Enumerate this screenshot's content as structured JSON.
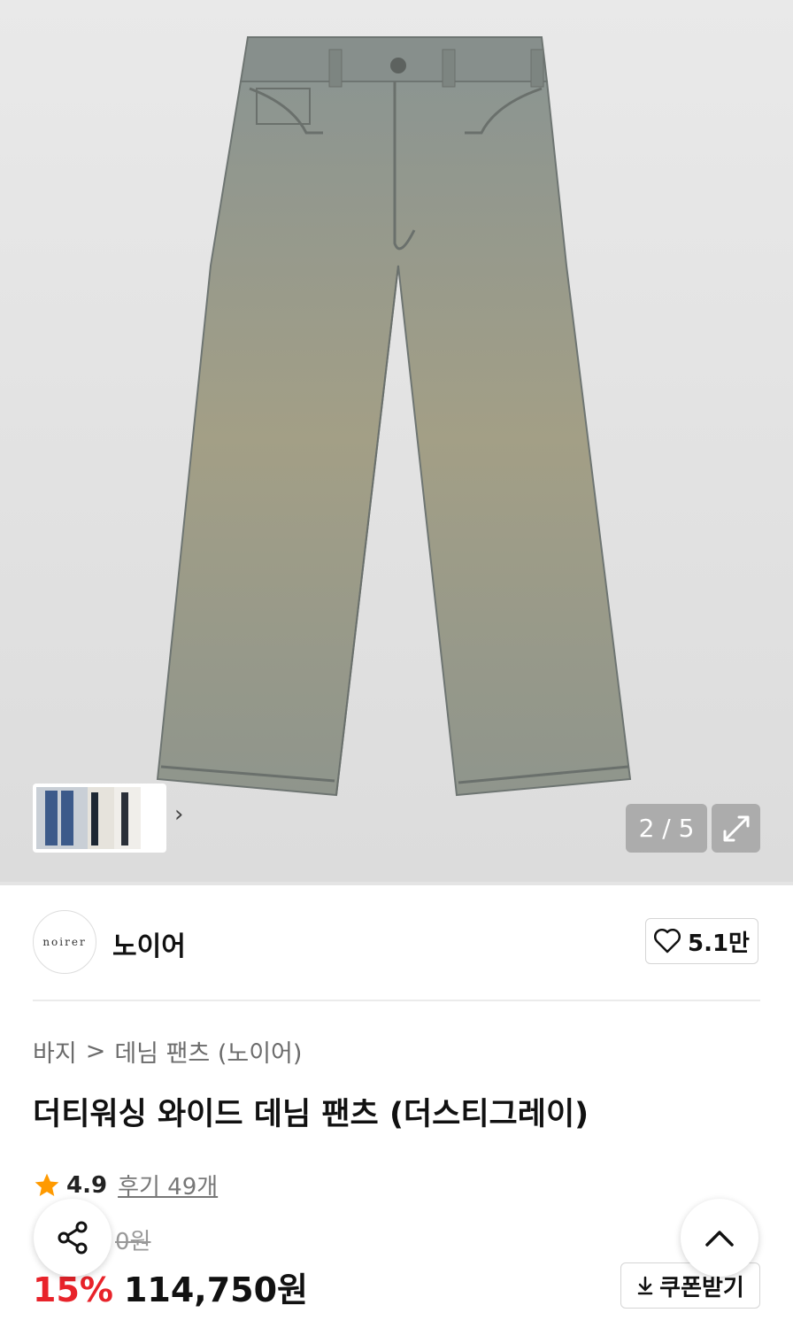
{
  "gallery": {
    "counter": "2 / 5",
    "thumb_next": "›"
  },
  "brand": {
    "logo_text": "noirer",
    "name": "노이어",
    "likes": "5.1만"
  },
  "breadcrumb": {
    "category": "바지",
    "separator": ">",
    "subcategory": "데님 팬츠 (노이어)"
  },
  "product": {
    "title": "더티워싱 와이드 데님 팬츠 (더스티그레이)",
    "rating": "4.9",
    "reviews": "후기 49개",
    "original_price": "0원",
    "discount": "15%",
    "price": "114,750원",
    "coupon_label": "쿠폰받기"
  },
  "colors": {
    "accent_red": "#e8232a",
    "star": "#ff9a00"
  }
}
